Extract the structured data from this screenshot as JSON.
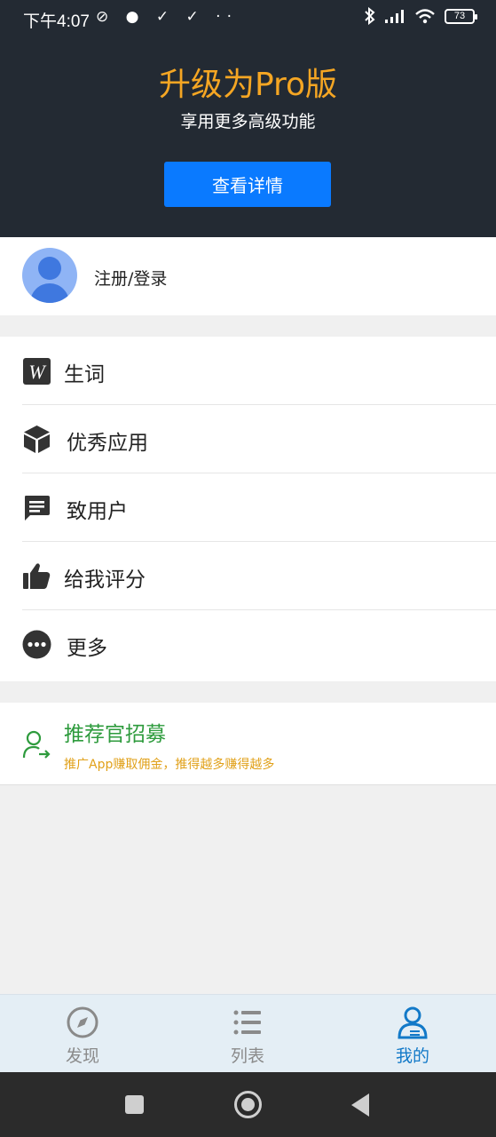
{
  "status_bar": {
    "time": "下午4:07",
    "left_icons": "⊘ ● ✓ ✓ ··",
    "battery": "73"
  },
  "promo": {
    "title": "升级为Pro版",
    "subtitle": "享用更多高级功能",
    "button_label": "查看详情"
  },
  "account": {
    "login_label": "注册/登录"
  },
  "menu": {
    "items": [
      {
        "label": "生词",
        "icon": "word-book-icon"
      },
      {
        "label": "优秀应用",
        "icon": "cube-icon"
      },
      {
        "label": "致用户",
        "icon": "message-icon"
      },
      {
        "label": "给我评分",
        "icon": "thumbs-up-icon"
      },
      {
        "label": "更多",
        "icon": "more-icon"
      }
    ]
  },
  "recruit": {
    "title": "推荐官招募",
    "subtitle": "推广App赚取佣金，推得越多赚得越多"
  },
  "tabs": [
    {
      "label": "发现",
      "icon": "compass-icon",
      "active": false
    },
    {
      "label": "列表",
      "icon": "list-icon",
      "active": false
    },
    {
      "label": "我的",
      "icon": "profile-icon",
      "active": true
    }
  ],
  "colors": {
    "header_bg": "#232a33",
    "pro_title": "#f5a623",
    "primary_button": "#0a7aff",
    "recruit_title": "#2e9b3d",
    "recruit_subtitle": "#e1a11a",
    "active_tab": "#1279c8"
  }
}
